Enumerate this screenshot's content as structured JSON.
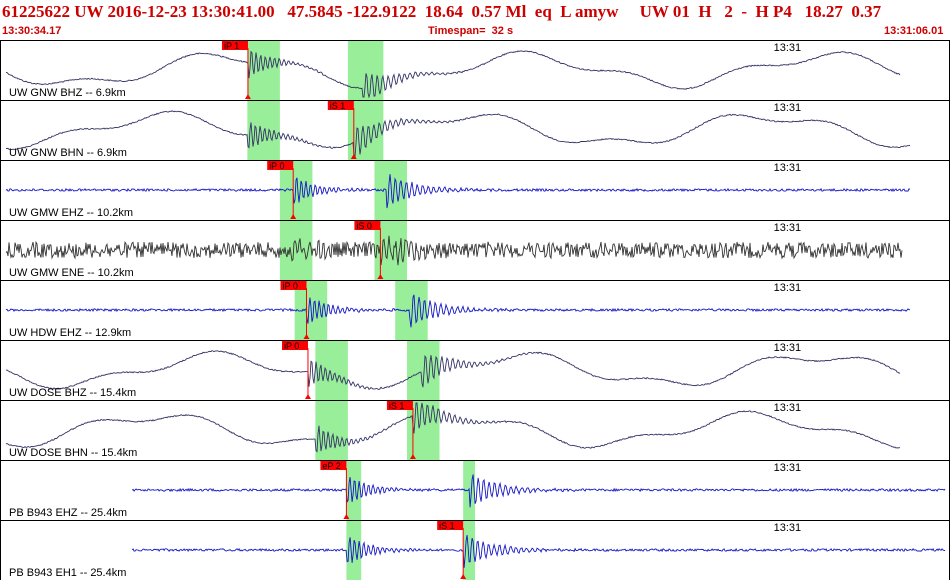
{
  "header": {
    "event_line": "61225622 UW 2016-12-23 13:30:41.00   47.5845 -122.9122  18.64  0.57 Ml  eq  L amyw     UW 01  H   2  -  H P4   18.27  0.37",
    "start_time": "13:30:34.17",
    "timespan": "Timespan=  32 s",
    "end_time": "13:31:06.01"
  },
  "colors": {
    "header_text": "#cc0000",
    "pick_flag": "#ff0000",
    "pick_window": "#99ee99",
    "trace_dark": "#333366",
    "trace_blue": "#1515c8",
    "trace_gray": "#333333",
    "frame": "#000000"
  },
  "panels": [
    {
      "label": "UW GNW BHZ -- 6.9km",
      "time_mark": "13:31",
      "color": "#333366",
      "style": "wave",
      "picks": [
        {
          "label": "iP 1",
          "t": 8.32,
          "win": [
            8.3,
            9.4
          ]
        },
        {
          "label": "S 1",
          "t": 12.2,
          "win": [
            11.7,
            12.9
          ]
        }
      ]
    },
    {
      "label": "UW GNW BHN -- 6.9km",
      "time_mark": "13:31",
      "color": "#333366",
      "style": "wave",
      "picks": [
        {
          "label": "iS 1",
          "t": 11.9,
          "win": [
            11.7,
            12.9
          ]
        },
        {
          "label": "P",
          "t": 8.3,
          "win": [
            8.3,
            9.4
          ]
        }
      ]
    },
    {
      "label": "UW GMW EHZ -- 10.2km",
      "time_mark": "13:31",
      "color": "#1515c8",
      "style": "blue",
      "picks": [
        {
          "label": "iP 0",
          "t": 9.85,
          "win": [
            9.4,
            10.5
          ]
        },
        {
          "label": "S",
          "t": 13.0,
          "win": [
            12.6,
            13.7
          ]
        }
      ]
    },
    {
      "label": "UW GMW ENE -- 10.2km",
      "time_mark": "13:31",
      "color": "#333333",
      "style": "noise",
      "picks": [
        {
          "label": "iS 0",
          "t": 12.8,
          "win": [
            12.6,
            13.7
          ]
        },
        {
          "label": "P",
          "t": 9.8,
          "win": [
            9.4,
            10.5
          ]
        }
      ]
    },
    {
      "label": "UW HDW EHZ -- 12.9km",
      "time_mark": "13:31",
      "color": "#1515c8",
      "style": "blue",
      "picks": [
        {
          "label": "iP 0",
          "t": 10.3,
          "win": [
            9.9,
            11.0
          ]
        },
        {
          "label": "S",
          "t": 13.8,
          "win": [
            13.3,
            14.4
          ]
        }
      ]
    },
    {
      "label": "UW DOSE BHZ -- 15.4km",
      "time_mark": "13:31",
      "color": "#333366",
      "style": "wave",
      "picks": [
        {
          "label": "iP 0",
          "t": 10.35,
          "win": [
            10.6,
            11.7
          ]
        },
        {
          "label": "S",
          "t": 14.2,
          "win": [
            13.7,
            14.8
          ]
        }
      ]
    },
    {
      "label": "UW DOSE BHN -- 15.4km",
      "time_mark": "13:31",
      "color": "#333366",
      "style": "wave",
      "picks": [
        {
          "label": "iS 1",
          "t": 13.9,
          "win": [
            13.7,
            14.8
          ]
        },
        {
          "label": "P",
          "t": 10.6,
          "win": [
            10.6,
            11.7
          ]
        }
      ]
    },
    {
      "label": "PB B943 EHZ -- 25.4km",
      "time_mark": "13:31",
      "color": "#1515c8",
      "style": "blue",
      "picks": [
        {
          "label": "eP 2",
          "t": 11.65,
          "win": [
            11.65,
            12.15
          ]
        },
        {
          "label": "S",
          "t": 15.8,
          "win": [
            15.6,
            16.0
          ]
        }
      ]
    },
    {
      "label": "PB B943 EH1 -- 25.4km",
      "time_mark": "13:31",
      "color": "#1515c8",
      "style": "blue",
      "picks": [
        {
          "label": "iS 1",
          "t": 15.6,
          "win": [
            15.6,
            16.0
          ]
        },
        {
          "label": "P",
          "t": 11.65,
          "win": [
            11.65,
            12.15
          ]
        }
      ]
    }
  ],
  "timeline": {
    "span_seconds": 32,
    "mark_seconds": 26.1
  }
}
